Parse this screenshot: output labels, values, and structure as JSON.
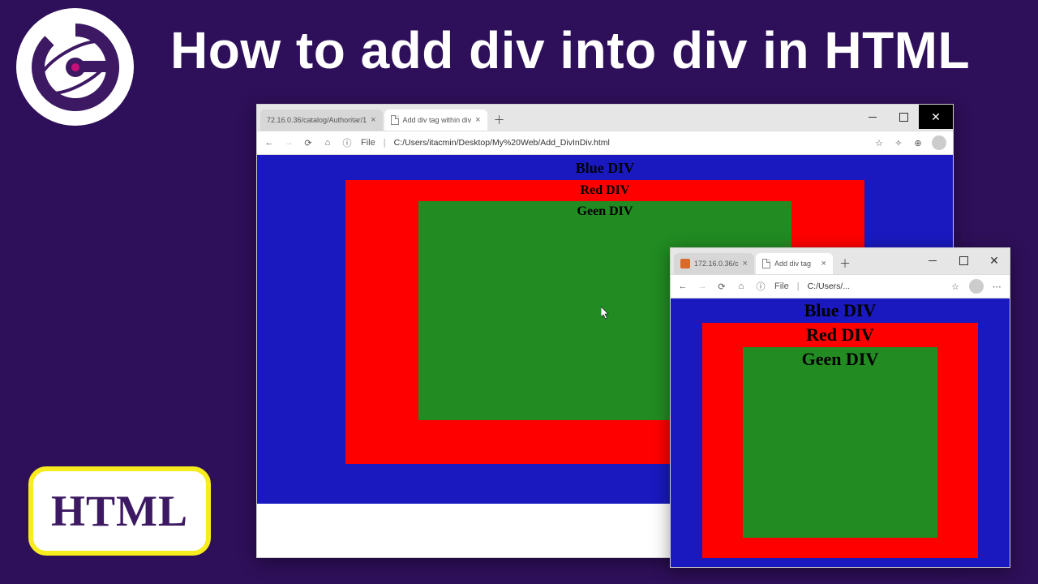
{
  "title": "How to add div into div in HTML",
  "badge_text": "HTML",
  "large_window": {
    "tabs": [
      {
        "label": "72.16.0.36/catalog/Authoritar/1",
        "active": false
      },
      {
        "label": "Add div tag within div",
        "active": true
      }
    ],
    "address": {
      "scheme_label": "File",
      "url": "C:/Users/itacmin/Desktop/My%20Web/Add_DivInDiv.html"
    },
    "page": {
      "blue_label": "Blue DIV",
      "red_label": "Red DIV",
      "green_label": "Geen DIV"
    }
  },
  "small_window": {
    "tabs": [
      {
        "label": "172.16.0.36/c",
        "active": false
      },
      {
        "label": "Add div tag",
        "active": true
      }
    ],
    "address": {
      "scheme_label": "File",
      "url": "C:/Users/..."
    },
    "page": {
      "blue_label": "Blue DIV",
      "red_label": "Red DIV",
      "green_label": "Geen DIV"
    }
  }
}
